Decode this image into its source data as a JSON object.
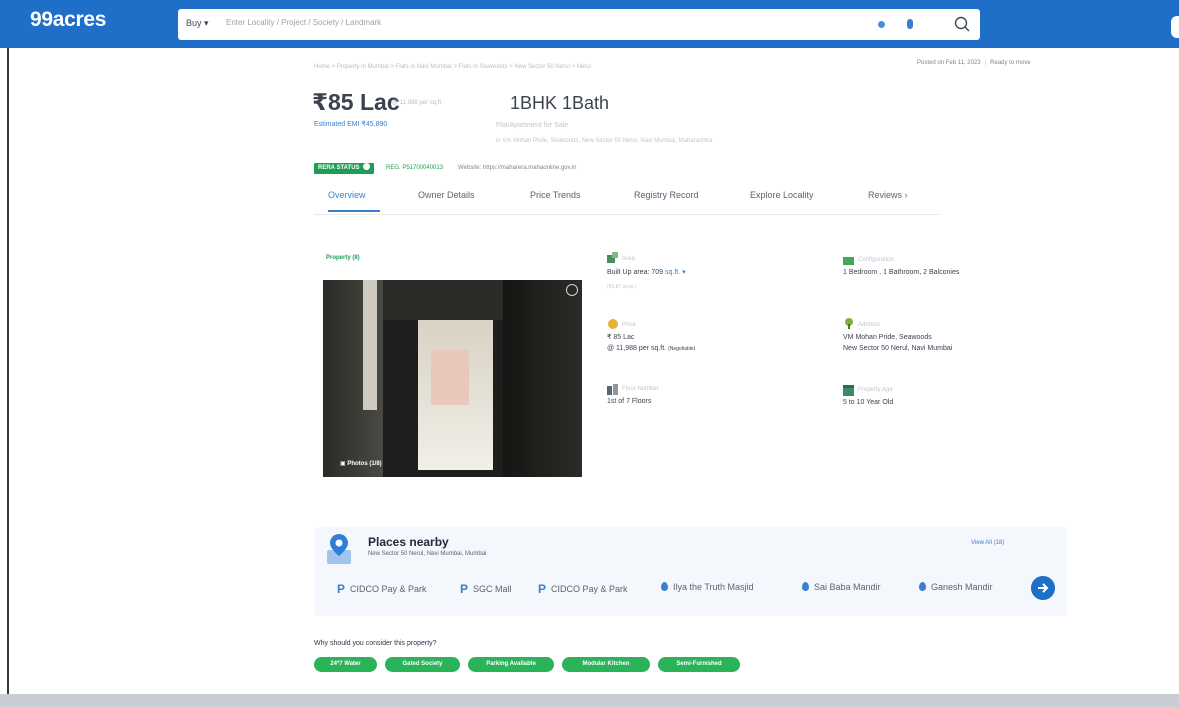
{
  "header": {
    "logo": "99acres",
    "buy_label": "Buy ▾",
    "search_placeholder": "Enter Locality / Project / Society / Landmark"
  },
  "breadcrumb": "Home > Property in Mumbai > Flats in Navi Mumbai > Flats in Seawoods > New Sector 50 Nerul > Nerul",
  "posted": {
    "date": "Posted on Feb 11, 2023",
    "status": "Ready to move"
  },
  "listing": {
    "price": "₹85 Lac",
    "price_sub": "@ 11,988 per sq.ft.",
    "emi": "Estimated EMI ₹45,890",
    "title": "1BHK 1Bath",
    "subtitle": "Flat/Apartment for Sale",
    "address": "in Vm Mohan Pride, Seawoods, New Sector 50 Nerul, Navi Mumbai, Maharashtra",
    "rera_badge": "RERA STATUS",
    "reg_no": "REG. P51700040013",
    "website": "Website: https://maharera.mahaonline.gov.in"
  },
  "tabs": [
    "Overview",
    "Owner Details",
    "Price Trends",
    "Registry Record",
    "Explore Locality",
    "Reviews"
  ],
  "property": {
    "label": "Property (8)",
    "photos_btn": "Photos (1/8)",
    "area_label": "Area",
    "area_value": "Built Up area: 709",
    "area_unit": "sq.ft. ▾",
    "area_alt": "(65.87 sq.m.)",
    "config_label": "Configuration",
    "config_value": "1 Bedroom , 1 Bathroom, 2 Balconies",
    "price_label": "Price",
    "price_value": "₹ 85 Lac",
    "price_per": "@ 11,988 per sq.ft.",
    "price_neg": "(Negotiable)",
    "address_label": "Address",
    "address_line1": "VM Mohan Pride, Seawoods",
    "address_line2": "New Sector 50 Nerul, Navi Mumbai",
    "floor_label": "Floor Number",
    "floor_value": "1st of 7 Floors",
    "age_label": "Property Age",
    "age_value": "5 to 10 Year Old"
  },
  "places": {
    "title": "Places nearby",
    "subtitle": "New Sector 50 Nerul, Navi Mumbai, Mumbai",
    "view_all": "View All (18)",
    "items": [
      "CIDCO Pay & Park",
      "SGC Mall",
      "CIDCO Pay & Park",
      "Ilya the Truth Masjid",
      "Sai Baba Mandir",
      "Ganesh Mandir"
    ]
  },
  "why": {
    "title": "Why should you consider this property?",
    "chips": [
      "24*7 Water",
      "Gated Society",
      "Parking Available",
      "Modular Kitchen",
      "Semi-Furnished"
    ]
  },
  "colors": {
    "brand": "#1f6fc9",
    "green": "#2bb35a",
    "link": "#3b7fd0"
  }
}
